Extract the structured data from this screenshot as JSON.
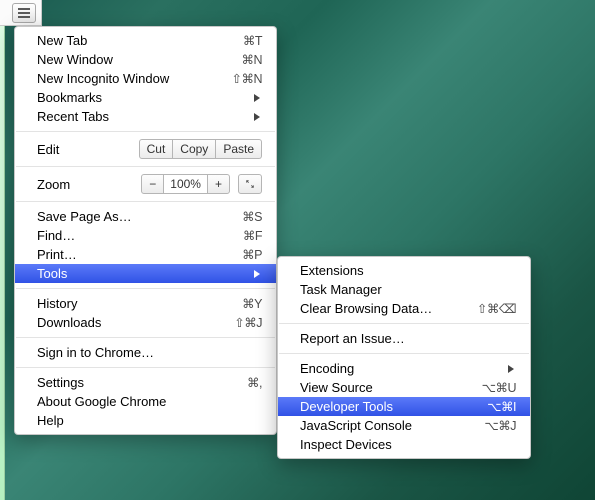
{
  "main_menu": {
    "new_tab": {
      "label": "New Tab",
      "shortcut": "⌘T"
    },
    "new_window": {
      "label": "New Window",
      "shortcut": "⌘N"
    },
    "new_incognito": {
      "label": "New Incognito Window",
      "shortcut": "⇧⌘N"
    },
    "bookmarks": {
      "label": "Bookmarks"
    },
    "recent_tabs": {
      "label": "Recent Tabs"
    },
    "edit": {
      "label": "Edit",
      "cut": "Cut",
      "copy": "Copy",
      "paste": "Paste"
    },
    "zoom": {
      "label": "Zoom",
      "value": "100%",
      "minus": "−",
      "plus": "+"
    },
    "save_page": {
      "label": "Save Page As…",
      "shortcut": "⌘S"
    },
    "find": {
      "label": "Find…",
      "shortcut": "⌘F"
    },
    "print": {
      "label": "Print…",
      "shortcut": "⌘P"
    },
    "tools": {
      "label": "Tools"
    },
    "history": {
      "label": "History",
      "shortcut": "⌘Y"
    },
    "downloads": {
      "label": "Downloads",
      "shortcut": "⇧⌘J"
    },
    "sign_in": {
      "label": "Sign in to Chrome…"
    },
    "settings": {
      "label": "Settings",
      "shortcut": "⌘,"
    },
    "about": {
      "label": "About Google Chrome"
    },
    "help": {
      "label": "Help"
    }
  },
  "sub_menu": {
    "extensions": {
      "label": "Extensions"
    },
    "task_manager": {
      "label": "Task Manager"
    },
    "clear_data": {
      "label": "Clear Browsing Data…",
      "shortcut": "⇧⌘⌫"
    },
    "report_issue": {
      "label": "Report an Issue…"
    },
    "encoding": {
      "label": "Encoding"
    },
    "view_source": {
      "label": "View Source",
      "shortcut": "⌥⌘U"
    },
    "developer_tools": {
      "label": "Developer Tools",
      "shortcut": "⌥⌘I"
    },
    "js_console": {
      "label": "JavaScript Console",
      "shortcut": "⌥⌘J"
    },
    "inspect_devices": {
      "label": "Inspect Devices"
    }
  }
}
